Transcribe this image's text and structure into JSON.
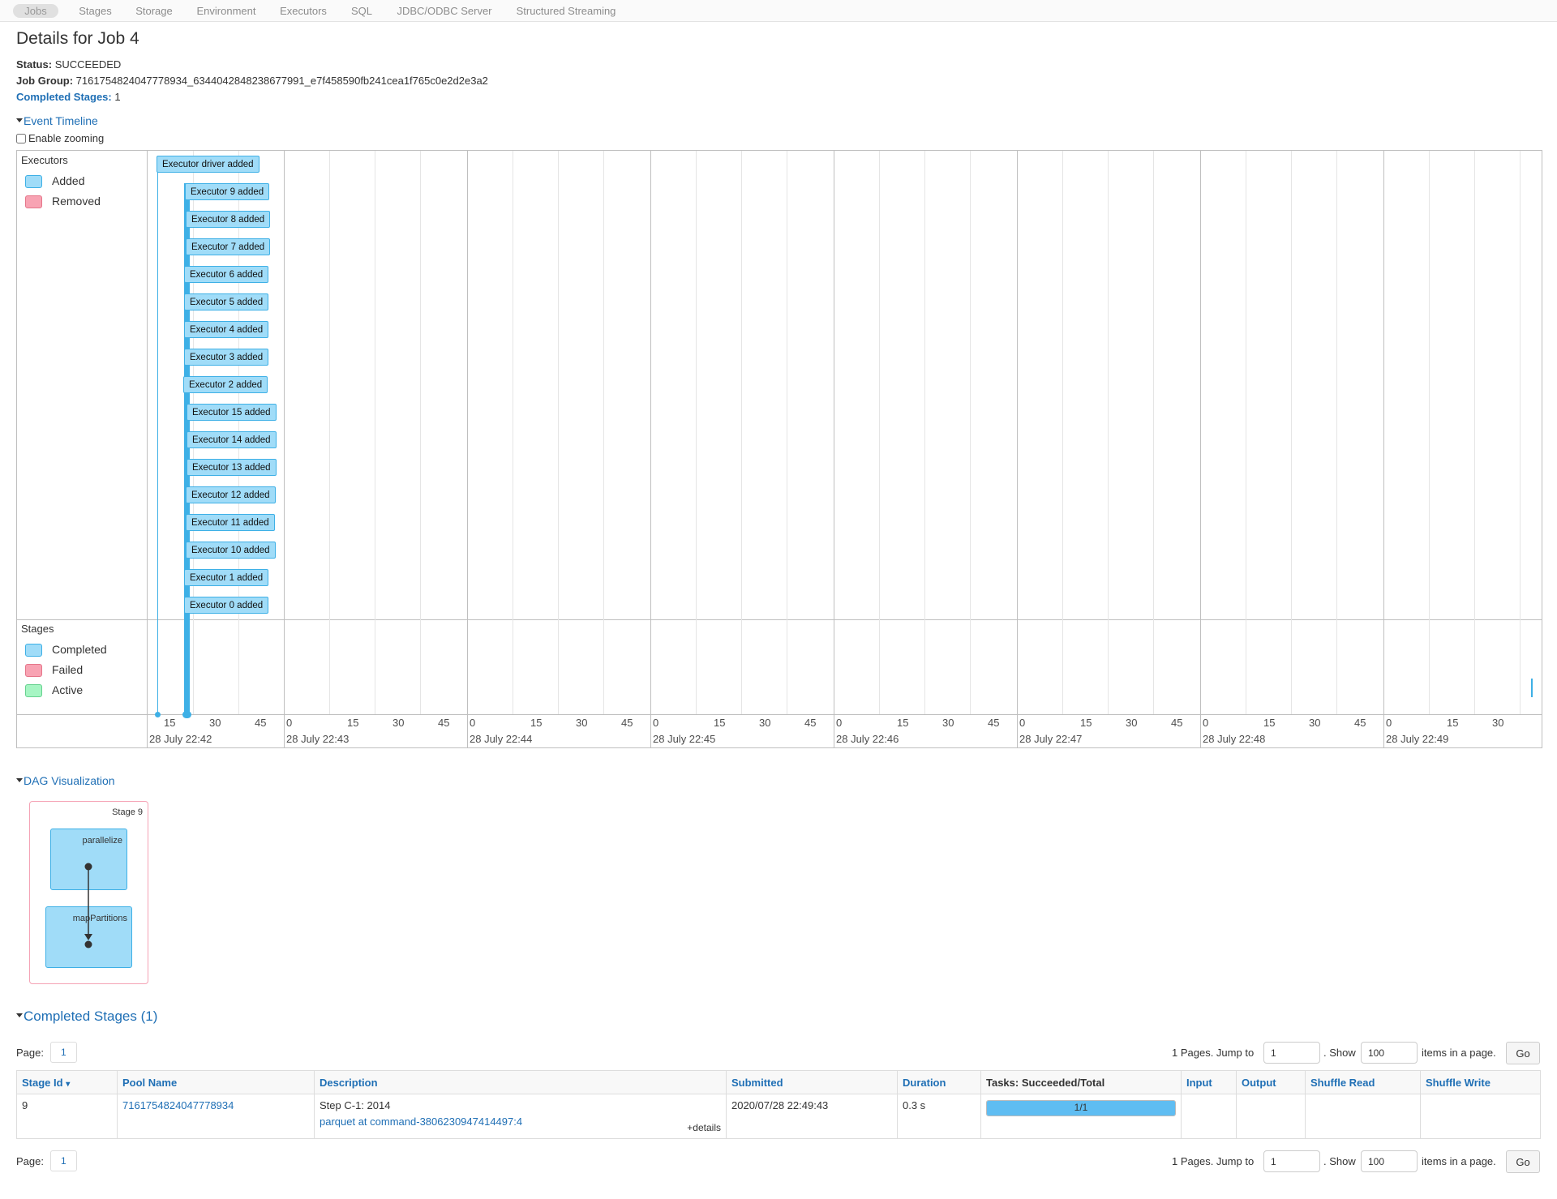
{
  "nav": {
    "tabs": [
      "Jobs",
      "Stages",
      "Storage",
      "Environment",
      "Executors",
      "SQL",
      "JDBC/ODBC Server",
      "Structured Streaming"
    ],
    "active": "Jobs"
  },
  "page": {
    "title": "Details for Job 4",
    "status_label": "Status:",
    "status_value": "SUCCEEDED",
    "job_group_label": "Job Group:",
    "job_group_value": "7161754824047778934_6344042848238677991_e7f458590fb241cea1f765c0e2d2e3a2",
    "completed_stages_label": "Completed Stages:",
    "completed_stages_value": "1"
  },
  "timeline": {
    "toggle_label": "Event Timeline",
    "zoom_label": "Enable zooming",
    "executors_lane": "Executors",
    "executor_legend": [
      {
        "label": "Added",
        "color": "#a0dcf8",
        "border": "#3eb0e6"
      },
      {
        "label": "Removed",
        "color": "#f8a3b3",
        "border": "#e5768a"
      }
    ],
    "stages_lane": "Stages",
    "stage_legend": [
      {
        "label": "Completed",
        "color": "#a0dcf8",
        "border": "#3eb0e6"
      },
      {
        "label": "Failed",
        "color": "#f8a3b3",
        "border": "#e5768a"
      },
      {
        "label": "Active",
        "color": "#a6f5c3",
        "border": "#66d18f"
      }
    ],
    "executor_events": [
      "Executor driver added",
      "Executor 9 added",
      "Executor 8 added",
      "Executor 7 added",
      "Executor 6 added",
      "Executor 5 added",
      "Executor 4 added",
      "Executor 3 added",
      "Executor 2 added",
      "Executor 15 added",
      "Executor 14 added",
      "Executor 13 added",
      "Executor 12 added",
      "Executor 11 added",
      "Executor 10 added",
      "Executor 1 added",
      "Executor 0 added"
    ],
    "minute_labels": [
      "28 July 22:42",
      "28 July 22:43",
      "28 July 22:44",
      "28 July 22:45",
      "28 July 22:46",
      "28 July 22:47",
      "28 July 22:48",
      "28 July 22:49"
    ],
    "tick_labels": [
      "0",
      "15",
      "30",
      "45"
    ]
  },
  "dag": {
    "toggle_label": "DAG Visualization",
    "stage_label": "Stage 9",
    "node1": "parallelize",
    "node2": "mapPartitions"
  },
  "completed": {
    "toggle_label": "Completed Stages (1)",
    "page_label": "Page:",
    "page_num": "1",
    "pages_text": "1 Pages. Jump to",
    "jump_value": "1",
    "show_text": ". Show",
    "show_value": "100",
    "items_text": "items in a page.",
    "go_label": "Go",
    "columns": [
      "Stage Id",
      "Pool Name",
      "Description",
      "Submitted",
      "Duration",
      "Tasks: Succeeded/Total",
      "Input",
      "Output",
      "Shuffle Read",
      "Shuffle Write"
    ],
    "sort_indicator": "▾",
    "rows": [
      {
        "stage_id": "9",
        "pool_name": "7161754824047778934",
        "desc_line1": "Step C-1: 2014",
        "desc_link": "parquet at command-3806230947414497:4",
        "details": "+details",
        "submitted": "2020/07/28 22:49:43",
        "duration": "0.3 s",
        "tasks": "1/1",
        "tasks_fraction": 1.0,
        "input": "",
        "output": "",
        "shuffle_read": "",
        "shuffle_write": ""
      }
    ]
  }
}
